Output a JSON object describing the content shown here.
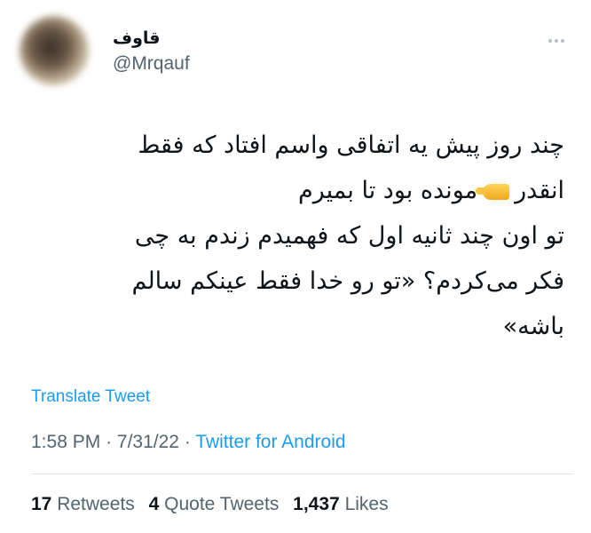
{
  "author": {
    "name": "قاوف",
    "handle": "@Mrqauf"
  },
  "tweet": {
    "line1": "چند روز پیش یه اتفاقی واسم افتاد که فقط",
    "line2_part1": "انقدر",
    "line2_part2": "مونده بود تا بمیرم",
    "line3": "تو اون چند ثانیه اول که فهمیدم زندم به چی",
    "line4": "فکر می‌کردم؟ «تو رو خدا فقط عینکم سالم",
    "line5": "باشه»",
    "emoji": "pinching-hand-icon"
  },
  "translate_label": "Translate Tweet",
  "meta": {
    "time": "1:58 PM",
    "sep1": "·",
    "date": "7/31/22",
    "sep2": "·",
    "source": "Twitter for Android"
  },
  "stats": {
    "retweets_count": "17",
    "retweets_label": "Retweets",
    "quotes_count": "4",
    "quotes_label": "Quote Tweets",
    "likes_count": "1,437",
    "likes_label": "Likes"
  },
  "colors": {
    "link": "#1d9bf0",
    "secondary_text": "#536471",
    "primary_text": "#0f1419"
  }
}
